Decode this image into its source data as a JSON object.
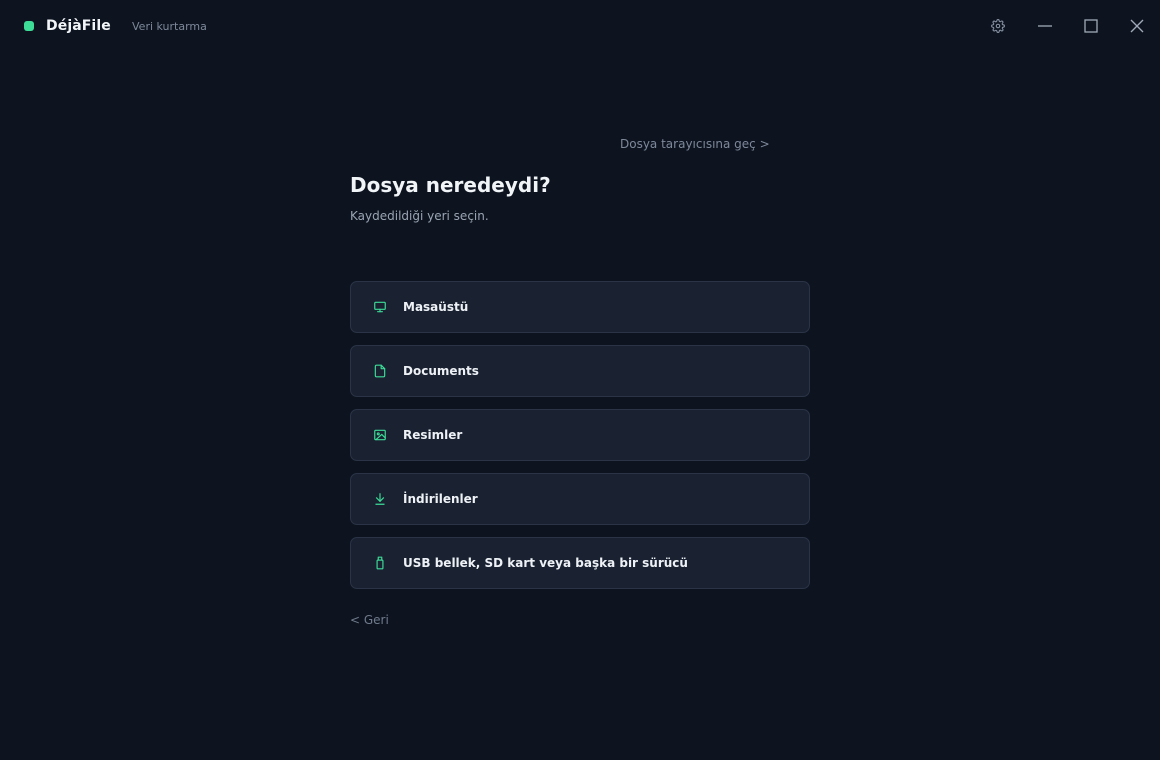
{
  "app": {
    "name": "DéjàFile",
    "subtitle": "Veri kurtarma",
    "accent_color": "#3ddc97"
  },
  "window_controls": [
    {
      "name": "settings",
      "icon": "gear-icon"
    },
    {
      "name": "minimize",
      "icon": "minimize-icon"
    },
    {
      "name": "maximize",
      "icon": "maximize-icon"
    },
    {
      "name": "close",
      "icon": "close-icon"
    }
  ],
  "main": {
    "browser_link": "Dosya tarayıcısına geç >",
    "title": "Dosya neredeydi?",
    "subtitle": "Kaydedildiği yeri seçin.",
    "options": [
      {
        "label": "Masaüstü",
        "icon": "monitor-icon"
      },
      {
        "label": "Documents",
        "icon": "document-icon"
      },
      {
        "label": "Resimler",
        "icon": "image-icon"
      },
      {
        "label": "İndirilenler",
        "icon": "download-icon"
      },
      {
        "label": "USB bellek, SD kart veya başka bir sürücü",
        "icon": "usb-drive-icon"
      }
    ],
    "back_link": "< Geri"
  }
}
